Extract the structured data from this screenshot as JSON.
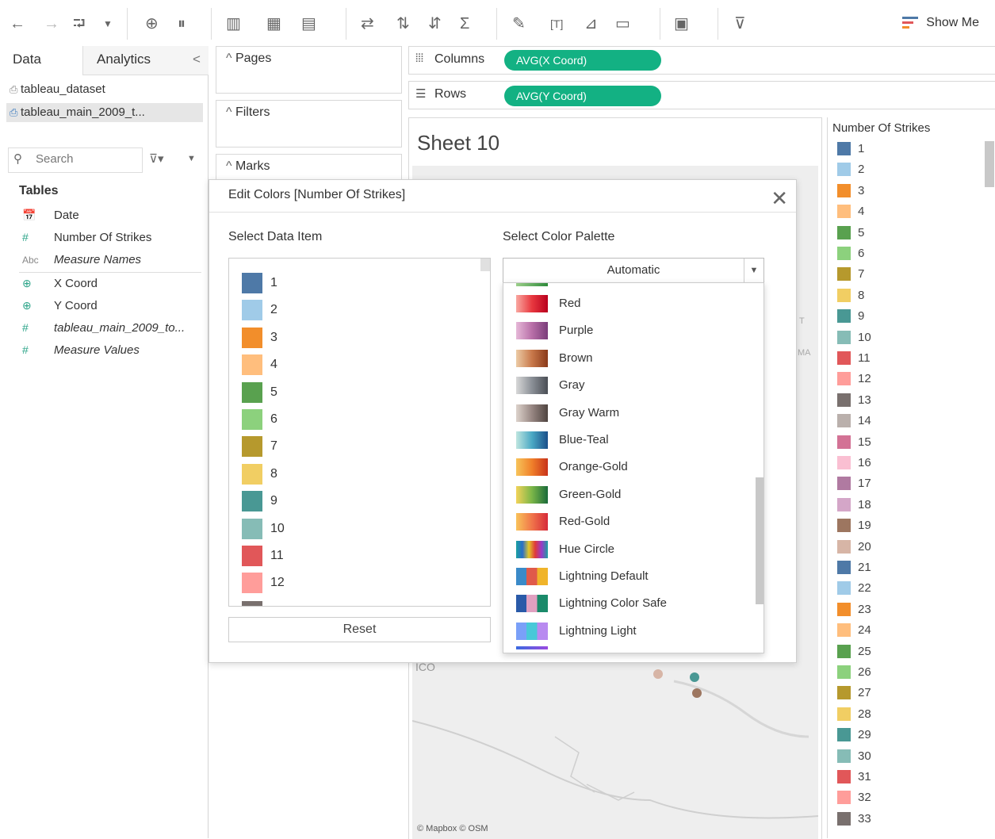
{
  "toolbar": {
    "show_me": "Show Me",
    "icons": [
      "back-icon",
      "forward-icon",
      "redo-icon",
      "dropdown-icon",
      "new-datasource-icon",
      "pause-icon",
      "new-sheet-icon",
      "duplicate-icon",
      "clear-icon",
      "swap-icon",
      "sort-asc-icon",
      "sort-desc-icon",
      "sum-icon",
      "highlight-icon",
      "text-icon",
      "annotate-icon",
      "fit-icon",
      "show-labels-icon",
      "presentation-icon"
    ]
  },
  "left": {
    "tab_data": "Data",
    "tab_analytics": "Analytics",
    "collapse": "<",
    "datasources": [
      "tableau_dataset",
      "tableau_main_2009_t..."
    ],
    "search_placeholder": "Search",
    "tables_header": "Tables",
    "fields": [
      {
        "icon": "📅",
        "label": "Date",
        "italic": false
      },
      {
        "icon": "#",
        "label": "Number Of Strikes",
        "italic": false
      },
      {
        "icon": "Abc",
        "label": "Measure Names",
        "italic": true
      },
      {
        "icon": "⊕",
        "label": "X Coord",
        "italic": false
      },
      {
        "icon": "⊕",
        "label": "Y Coord",
        "italic": false
      },
      {
        "icon": "#",
        "label": "tableau_main_2009_to...",
        "italic": true
      },
      {
        "icon": "#",
        "label": "Measure Values",
        "italic": true
      }
    ]
  },
  "shelves": {
    "pages": "Pages",
    "filters": "Filters",
    "marks": "Marks",
    "columns_label": "Columns",
    "rows_label": "Rows",
    "columns_pill": "AVG(X Coord)",
    "rows_pill": "AVG(Y Coord)"
  },
  "viz": {
    "sheet_title": "Sheet 10",
    "map_label_1": "T",
    "map_label_2": "MA",
    "map_label_3": "ICO",
    "attribution": "© Mapbox  © OSM"
  },
  "legend": {
    "title": "Number Of Strikes",
    "items": [
      {
        "label": "1",
        "color": "#4e79a7"
      },
      {
        "label": "2",
        "color": "#a0cbe8"
      },
      {
        "label": "3",
        "color": "#f28e2b"
      },
      {
        "label": "4",
        "color": "#ffbe7d"
      },
      {
        "label": "5",
        "color": "#59a14f"
      },
      {
        "label": "6",
        "color": "#8cd17d"
      },
      {
        "label": "7",
        "color": "#b6992d"
      },
      {
        "label": "8",
        "color": "#f1ce63"
      },
      {
        "label": "9",
        "color": "#499894"
      },
      {
        "label": "10",
        "color": "#86bcb6"
      },
      {
        "label": "11",
        "color": "#e15759"
      },
      {
        "label": "12",
        "color": "#ff9d9a"
      },
      {
        "label": "13",
        "color": "#79706e"
      },
      {
        "label": "14",
        "color": "#bab0ac"
      },
      {
        "label": "15",
        "color": "#d37295"
      },
      {
        "label": "16",
        "color": "#fabfd2"
      },
      {
        "label": "17",
        "color": "#b07aa1"
      },
      {
        "label": "18",
        "color": "#d4a6c8"
      },
      {
        "label": "19",
        "color": "#9d7660"
      },
      {
        "label": "20",
        "color": "#d7b5a6"
      },
      {
        "label": "21",
        "color": "#4e79a7"
      },
      {
        "label": "22",
        "color": "#a0cbe8"
      },
      {
        "label": "23",
        "color": "#f28e2b"
      },
      {
        "label": "24",
        "color": "#ffbe7d"
      },
      {
        "label": "25",
        "color": "#59a14f"
      },
      {
        "label": "26",
        "color": "#8cd17d"
      },
      {
        "label": "27",
        "color": "#b6992d"
      },
      {
        "label": "28",
        "color": "#f1ce63"
      },
      {
        "label": "29",
        "color": "#499894"
      },
      {
        "label": "30",
        "color": "#86bcb6"
      },
      {
        "label": "31",
        "color": "#e15759"
      },
      {
        "label": "32",
        "color": "#ff9d9a"
      },
      {
        "label": "33",
        "color": "#79706e"
      }
    ]
  },
  "dialog": {
    "title": "Edit Colors [Number Of Strikes]",
    "select_item_label": "Select Data Item",
    "select_palette_label": "Select Color Palette",
    "palette_selected": "Automatic",
    "reset": "Reset",
    "data_items": [
      {
        "label": "1",
        "color": "#4e79a7"
      },
      {
        "label": "2",
        "color": "#a0cbe8"
      },
      {
        "label": "3",
        "color": "#f28e2b"
      },
      {
        "label": "4",
        "color": "#ffbe7d"
      },
      {
        "label": "5",
        "color": "#59a14f"
      },
      {
        "label": "6",
        "color": "#8cd17d"
      },
      {
        "label": "7",
        "color": "#b6992d"
      },
      {
        "label": "8",
        "color": "#f1ce63"
      },
      {
        "label": "9",
        "color": "#499894"
      },
      {
        "label": "10",
        "color": "#86bcb6"
      },
      {
        "label": "11",
        "color": "#e15759"
      },
      {
        "label": "12",
        "color": "#ff9d9a"
      }
    ],
    "palettes": [
      {
        "label": "Red",
        "gradient": "linear-gradient(90deg,#f9a7a0,#e8383f,#b9001e)"
      },
      {
        "label": "Purple",
        "gradient": "linear-gradient(90deg,#e6b8d8,#b86fa8,#7a3d7a)"
      },
      {
        "label": "Brown",
        "gradient": "linear-gradient(90deg,#eccba5,#c8784a,#8a3a1a)"
      },
      {
        "label": "Gray",
        "gradient": "linear-gradient(90deg,#d8d8d8,#8a8f96,#4a4e55)"
      },
      {
        "label": "Gray Warm",
        "gradient": "linear-gradient(90deg,#ddd3cc,#978682,#4f4440)"
      },
      {
        "label": "Blue-Teal",
        "gradient": "linear-gradient(90deg,#bfe6e0,#4aa8c4,#1a4f8a)"
      },
      {
        "label": "Orange-Gold",
        "gradient": "linear-gradient(90deg,#f7c45a,#f0802a,#c8321a)"
      },
      {
        "label": "Green-Gold",
        "gradient": "linear-gradient(90deg,#f2d35a,#7ab648,#1a6a3a)"
      },
      {
        "label": "Red-Gold",
        "gradient": "linear-gradient(90deg,#f9c35a,#f0754a,#d62a3a)"
      },
      {
        "label": "Hue Circle",
        "gradient": "linear-gradient(90deg,#1aa0a0,#2a6ec8,#e0c82a,#e03a3a,#9a3ac8,#1aa0a0)"
      },
      {
        "label": "Lightning Default",
        "gradient": "linear-gradient(90deg,#3a8ac8 0 33%,#e05a4a 33% 66%,#f0b42a 66%)"
      },
      {
        "label": "Lightning Color Safe",
        "gradient": "linear-gradient(90deg,#2a5aa8 0 33%,#e0a0c0 33% 66%,#1a8a6a 66%)"
      },
      {
        "label": "Lightning Light",
        "gradient": "linear-gradient(90deg,#7aa0f8 0 33%,#48c8d8 33% 66%,#b88af0 66%)"
      }
    ]
  }
}
